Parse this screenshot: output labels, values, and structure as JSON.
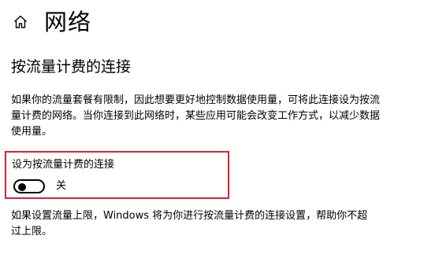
{
  "header": {
    "home_icon": "home-icon",
    "title": "网络"
  },
  "section": {
    "title": "按流量计费的连接",
    "description": "如果你的流量套餐有限制，因此想要更好地控制数据使用量，可将此连接设为按流量计费的网络。当你连接到此网络时，某些应用可能会改变工作方式，以减少数据使用量。"
  },
  "metered_toggle": {
    "label": "设为按流量计费的连接",
    "state_text": "关",
    "is_on": false,
    "highlight_color": "#e02030"
  },
  "footer": {
    "note": "如果设置流量上限，Windows 将为你进行按流量计费的连接设置，帮助你不超过上限。"
  }
}
